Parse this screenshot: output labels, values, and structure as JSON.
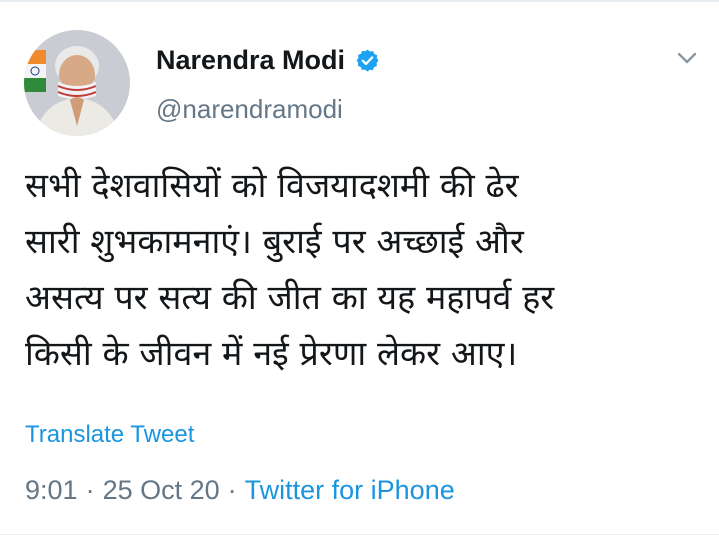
{
  "tweet": {
    "author": {
      "display_name": "Narendra Modi",
      "handle": "@narendramodi",
      "verified": true,
      "avatar": "profile-photo"
    },
    "text": "सभी देशवासियों को विजयादशमी की ढेर\nसारी शुभकामनाएं। बुराई पर अच्छाई और\nअसत्य पर सत्य की जीत का यह महापर्व हर\nकिसी के जीवन में नई प्रेरणा लेकर आए।",
    "translate_label": "Translate Tweet",
    "time": "9:01",
    "date": "25 Oct 20",
    "separator": "·",
    "source": "Twitter for iPhone"
  },
  "icons": {
    "verified": "verified-badge-icon",
    "menu": "chevron-down-icon"
  },
  "colors": {
    "link": "#1b95e0",
    "secondary_text": "#657786",
    "primary_text": "#14171a",
    "verified": "#1da1f2",
    "divider": "#e6ecf0"
  }
}
